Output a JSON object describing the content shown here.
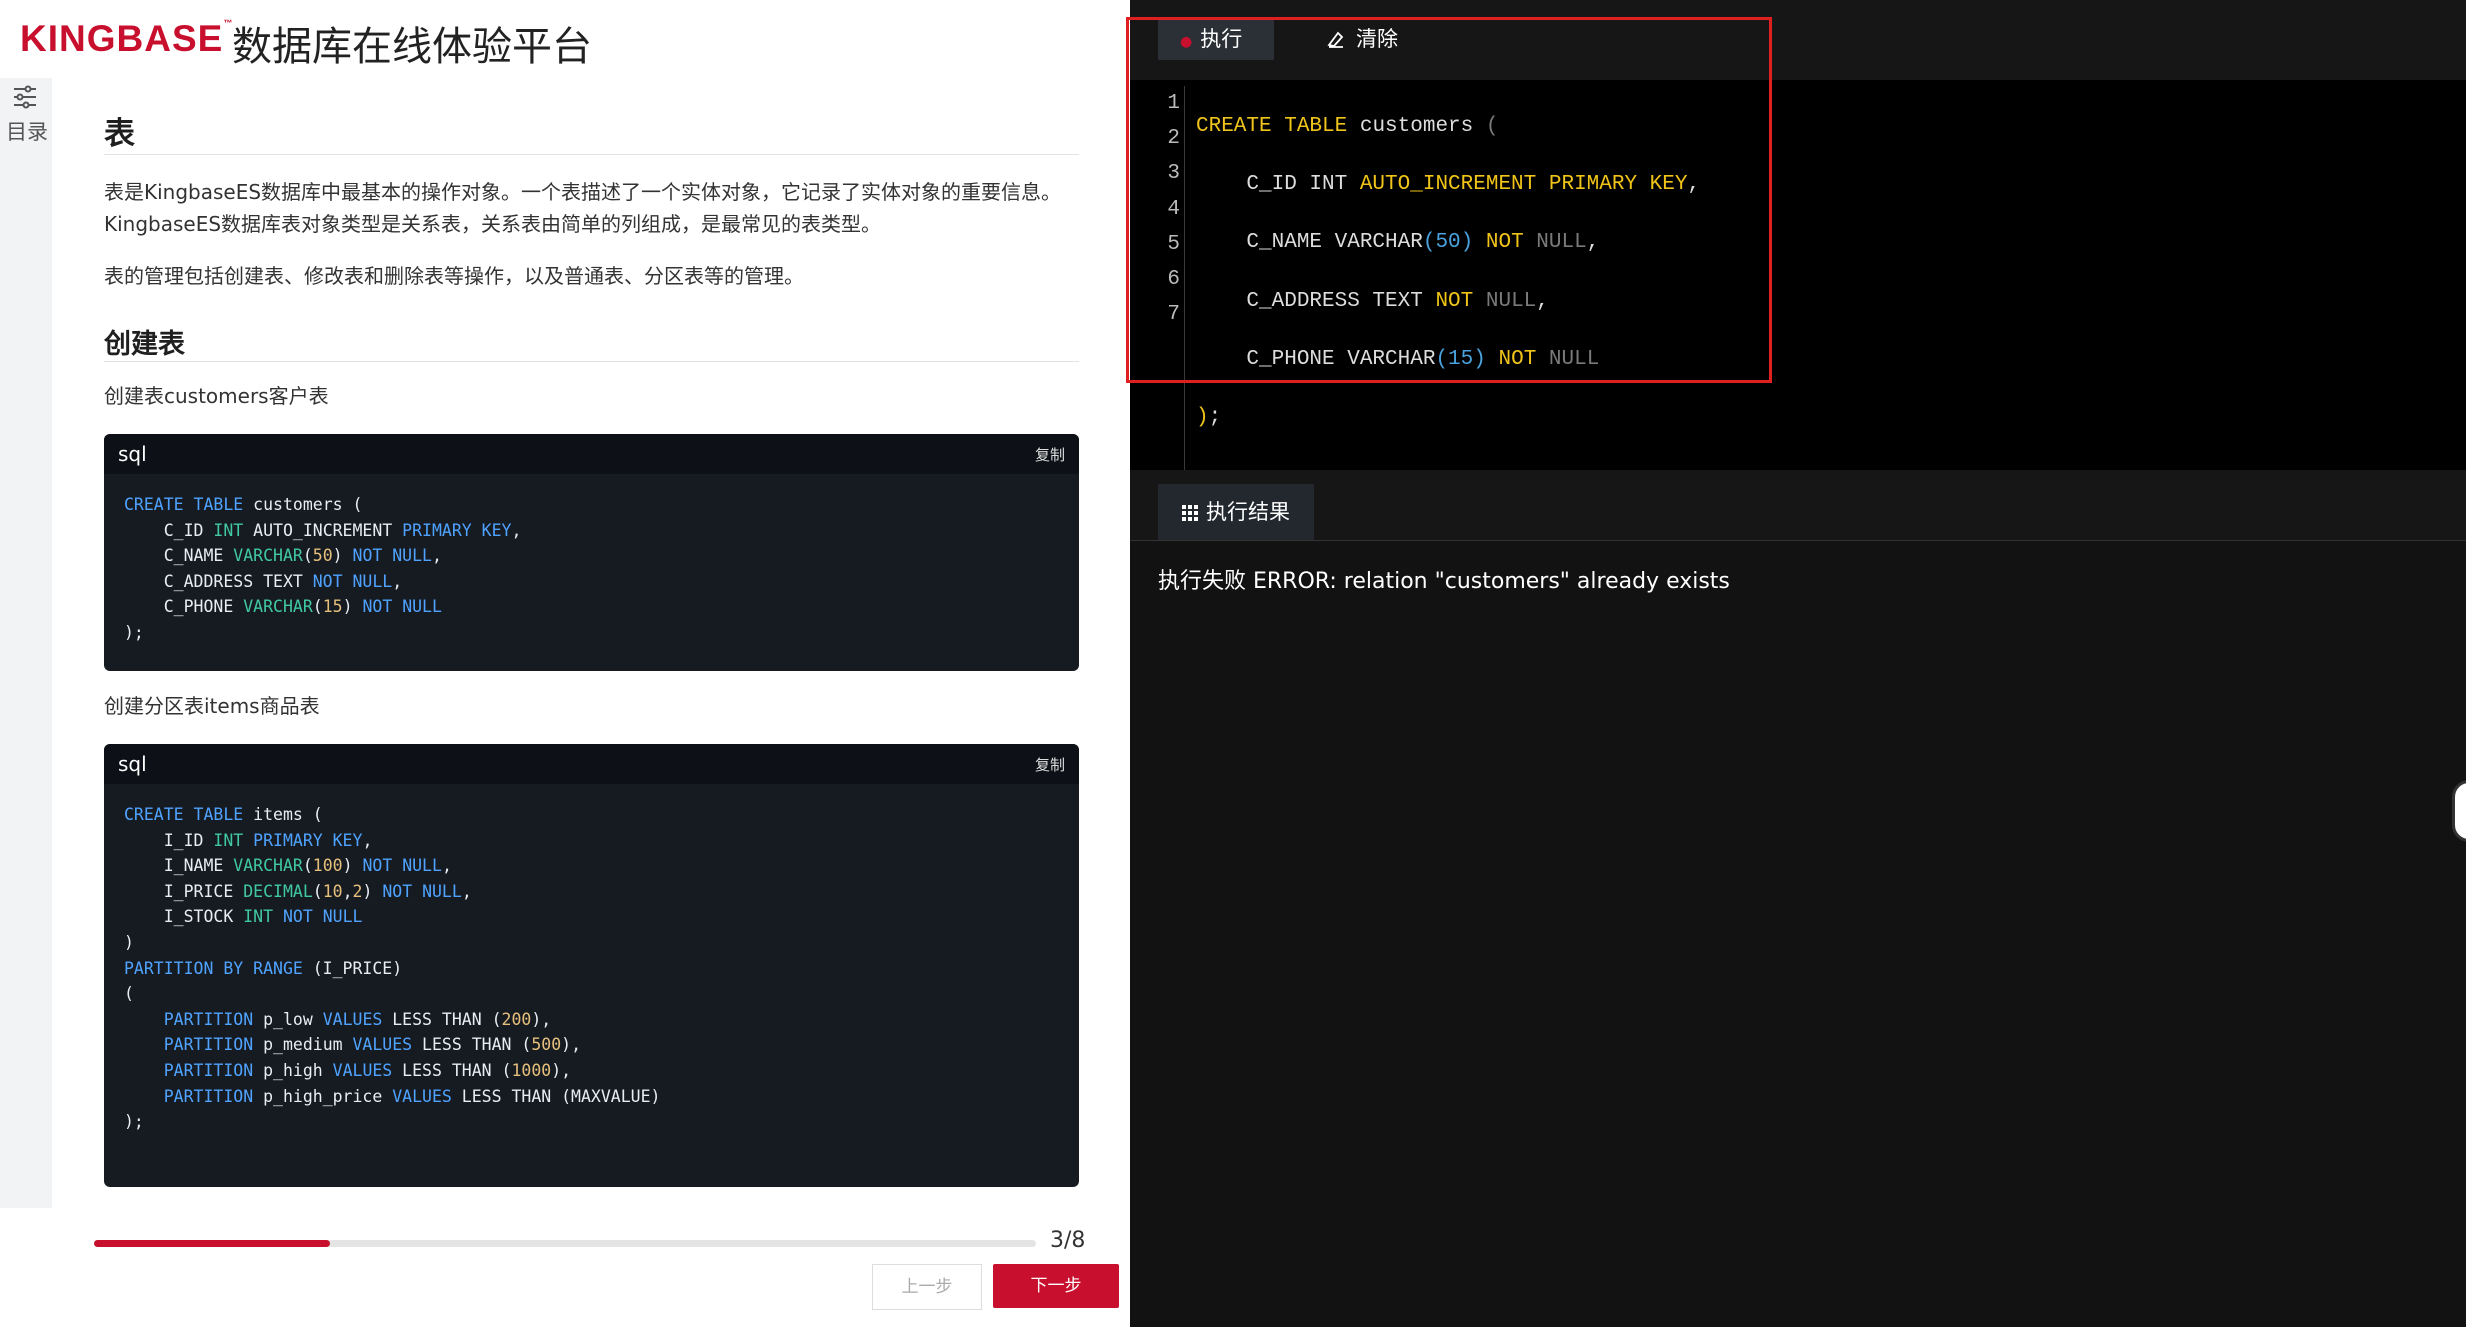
{
  "header": {
    "logo_text": "KINGBASE",
    "logo_tm": "™",
    "title": "数据库在线体验平台"
  },
  "toc": {
    "label": "目录"
  },
  "doc": {
    "section_title": "表",
    "intro_1": "表是KingbaseES数据库中最基本的操作对象。一个表描述了一个实体对象，它记录了实体对象的重要信息。KingbaseES数据库表对象类型是关系表，关系表由简单的列组成，是最常见的表类型。",
    "intro_2": "表的管理包括创建表、修改表和删除表等操作，以及普通表、分区表等的管理。",
    "sub_title": "创建表",
    "caption_1": "创建表customers客户表",
    "code1": {
      "lang": "sql",
      "copy": "复制"
    },
    "caption_2": "创建分区表items商品表",
    "code2": {
      "lang": "sql",
      "copy": "复制"
    }
  },
  "footer": {
    "progress_fraction": 0.25,
    "page": "3/8",
    "prev": "上一步",
    "next": "下一步"
  },
  "toolbar": {
    "run": "执行",
    "clear": "清除"
  },
  "editor": {
    "line_numbers": [
      "1",
      "2",
      "3",
      "4",
      "5",
      "6",
      "7"
    ]
  },
  "results": {
    "tab": "执行结果",
    "message": "执行失败 ERROR: relation \"customers\" already exists"
  },
  "colors": {
    "brand": "#c8102e",
    "editor_keyword": "#f0c419",
    "highlight_box": "#e02020"
  }
}
